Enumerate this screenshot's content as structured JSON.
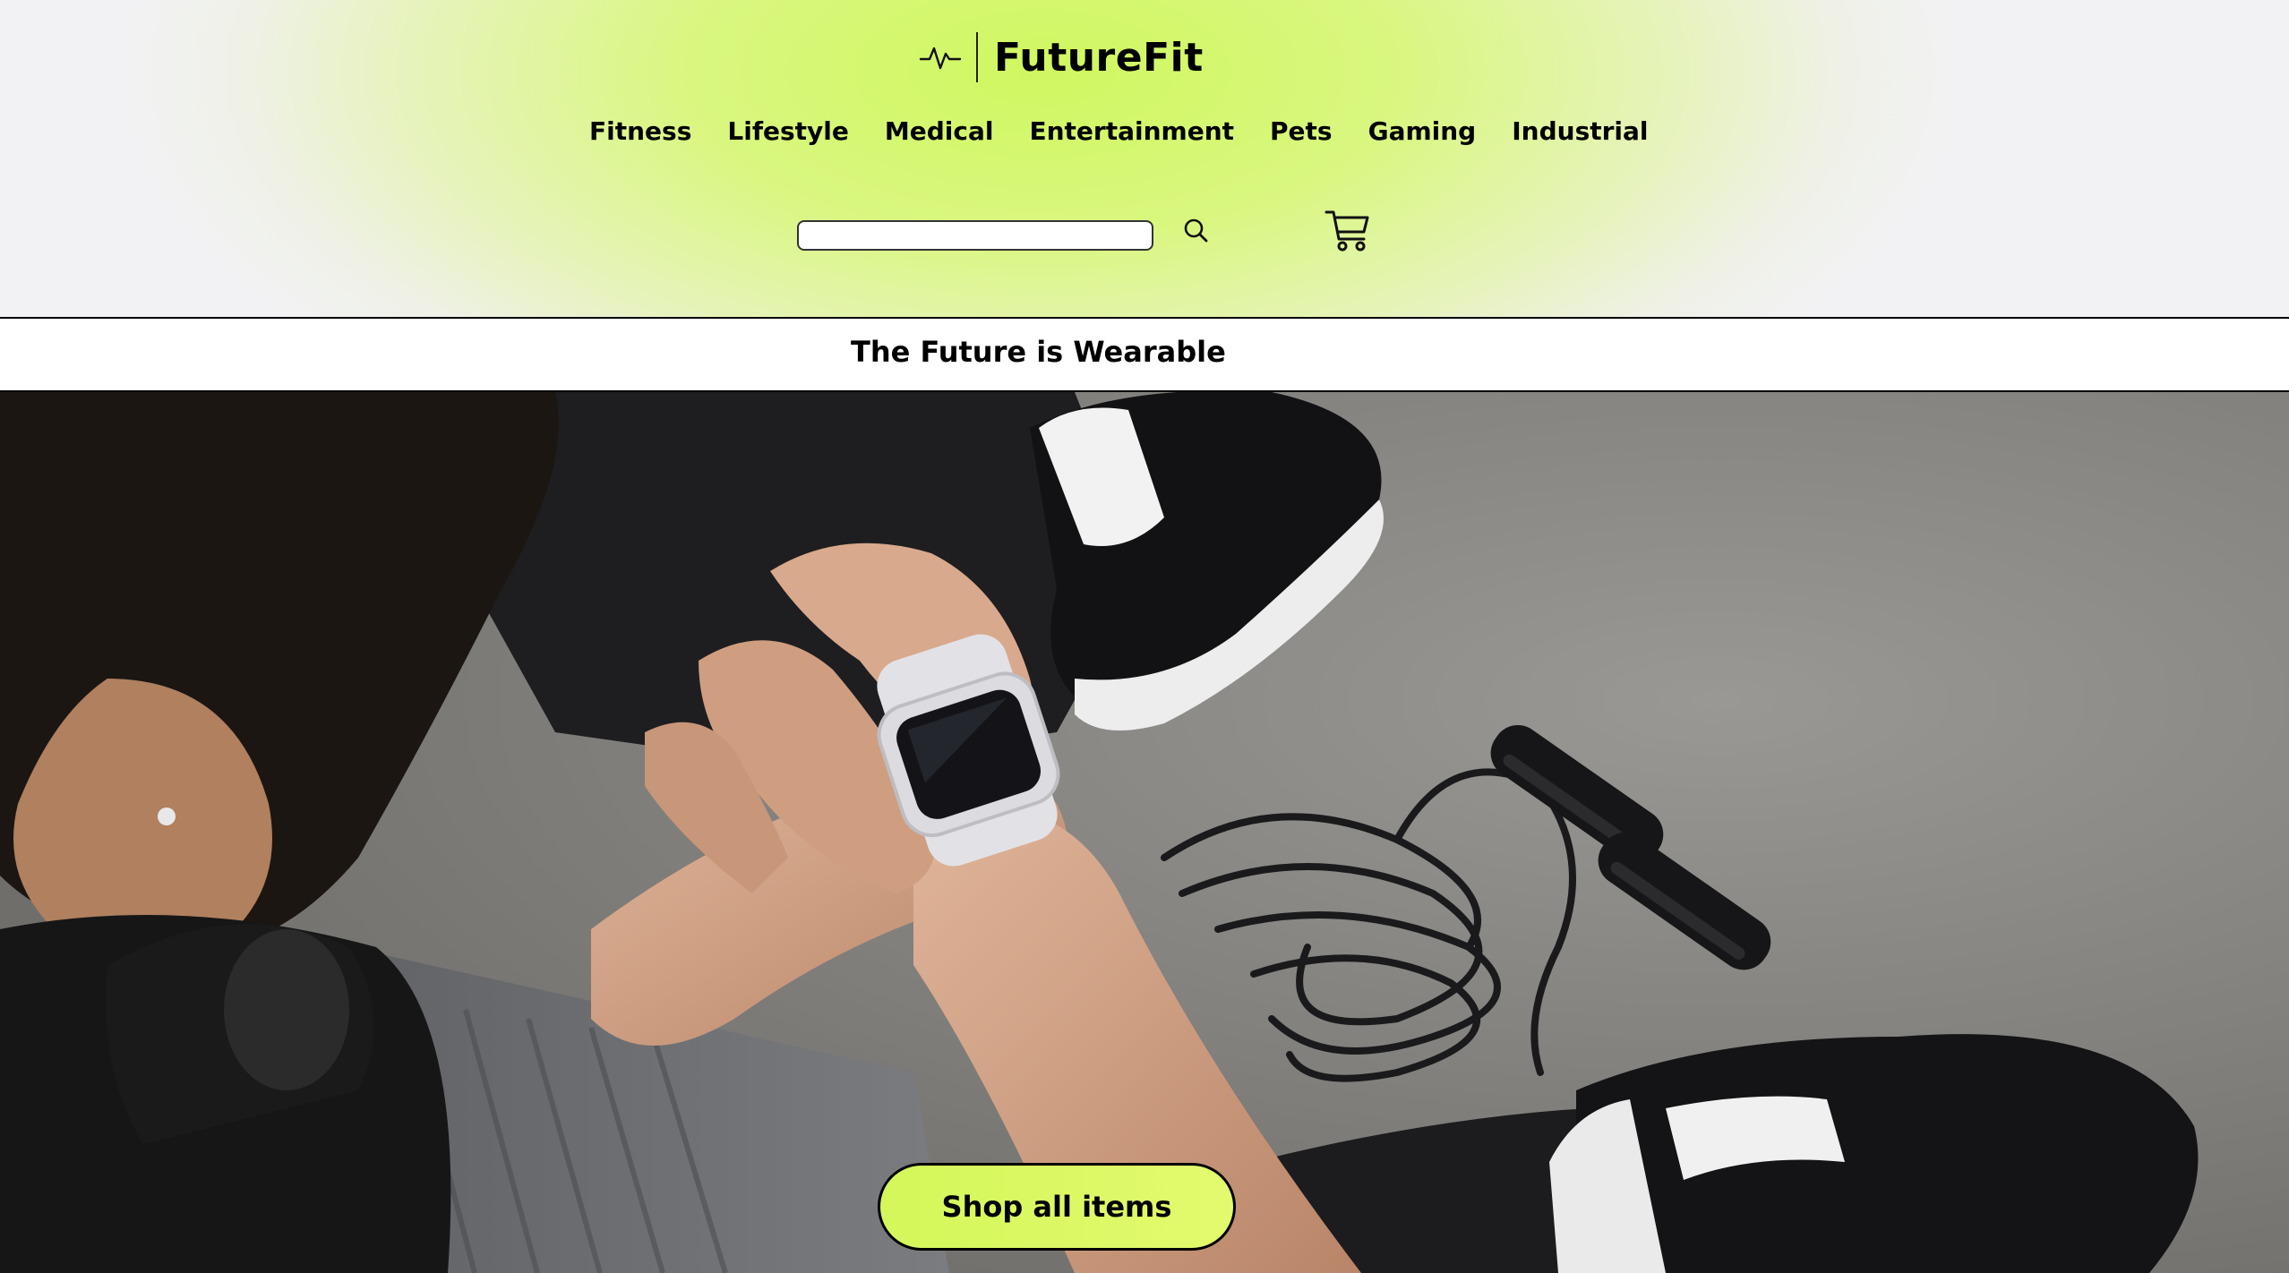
{
  "brand": {
    "name": "FutureFit",
    "logo_icon": "heartbeat-icon"
  },
  "nav": {
    "items": [
      {
        "label": "Fitness"
      },
      {
        "label": "Lifestyle"
      },
      {
        "label": "Medical"
      },
      {
        "label": "Entertainment"
      },
      {
        "label": "Pets"
      },
      {
        "label": "Gaming"
      },
      {
        "label": "Industrial"
      }
    ]
  },
  "search": {
    "value": "",
    "placeholder": "",
    "icon": "search-icon"
  },
  "cart": {
    "icon": "cart-icon"
  },
  "hero": {
    "tagline": "The Future is Wearable",
    "cta_label": "Shop all items",
    "image_subject": "hero-smartwatch-photo"
  },
  "colors": {
    "accent": "#d3f75a",
    "text": "#000000",
    "background": "#f2f2f4"
  }
}
